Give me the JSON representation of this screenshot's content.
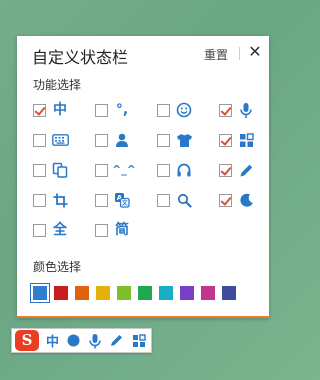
{
  "panel": {
    "title": "自定义状态栏",
    "reset_label": "重置",
    "close_glyph": "✕",
    "functions_label": "功能选择",
    "colors_label": "颜色选择"
  },
  "functions": [
    {
      "icon": "chinese-mode-icon",
      "glyph": "中",
      "checked": true
    },
    {
      "icon": "punctuation-icon",
      "glyph": "°,",
      "checked": false
    },
    {
      "icon": "smiley-icon",
      "glyph": "",
      "checked": false
    },
    {
      "icon": "microphone-icon",
      "glyph": "",
      "checked": true
    },
    {
      "icon": "keyboard-icon",
      "glyph": "",
      "checked": false
    },
    {
      "icon": "user-icon",
      "glyph": "",
      "checked": false
    },
    {
      "icon": "tshirt-icon",
      "glyph": "",
      "checked": false
    },
    {
      "icon": "grid-icon",
      "glyph": "",
      "checked": true
    },
    {
      "icon": "copy-icon",
      "glyph": "",
      "checked": false
    },
    {
      "icon": "emoticon-icon",
      "glyph": "^_^",
      "checked": false
    },
    {
      "icon": "headphones-icon",
      "glyph": "",
      "checked": false
    },
    {
      "icon": "pencil-icon",
      "glyph": "",
      "checked": true
    },
    {
      "icon": "crop-icon",
      "glyph": "",
      "checked": false
    },
    {
      "icon": "translate-icon",
      "glyph": "",
      "checked": false
    },
    {
      "icon": "search-icon",
      "glyph": "",
      "checked": false
    },
    {
      "icon": "moon-icon",
      "glyph": "",
      "checked": true
    },
    {
      "icon": "fullwidth-icon",
      "glyph": "全",
      "checked": false
    },
    {
      "icon": "simplified-icon",
      "glyph": "简",
      "checked": false
    }
  ],
  "colors": [
    "#2f7fd0",
    "#c81e1e",
    "#e0610f",
    "#e3b00e",
    "#7ebf2a",
    "#1fa84f",
    "#19aec6",
    "#7b3fc7",
    "#c2378d",
    "#3f4c9e"
  ],
  "selected_color_index": 0,
  "statusbar": {
    "logo_glyph": "S",
    "mode_glyph": "中",
    "accent": "#2a79c9"
  }
}
